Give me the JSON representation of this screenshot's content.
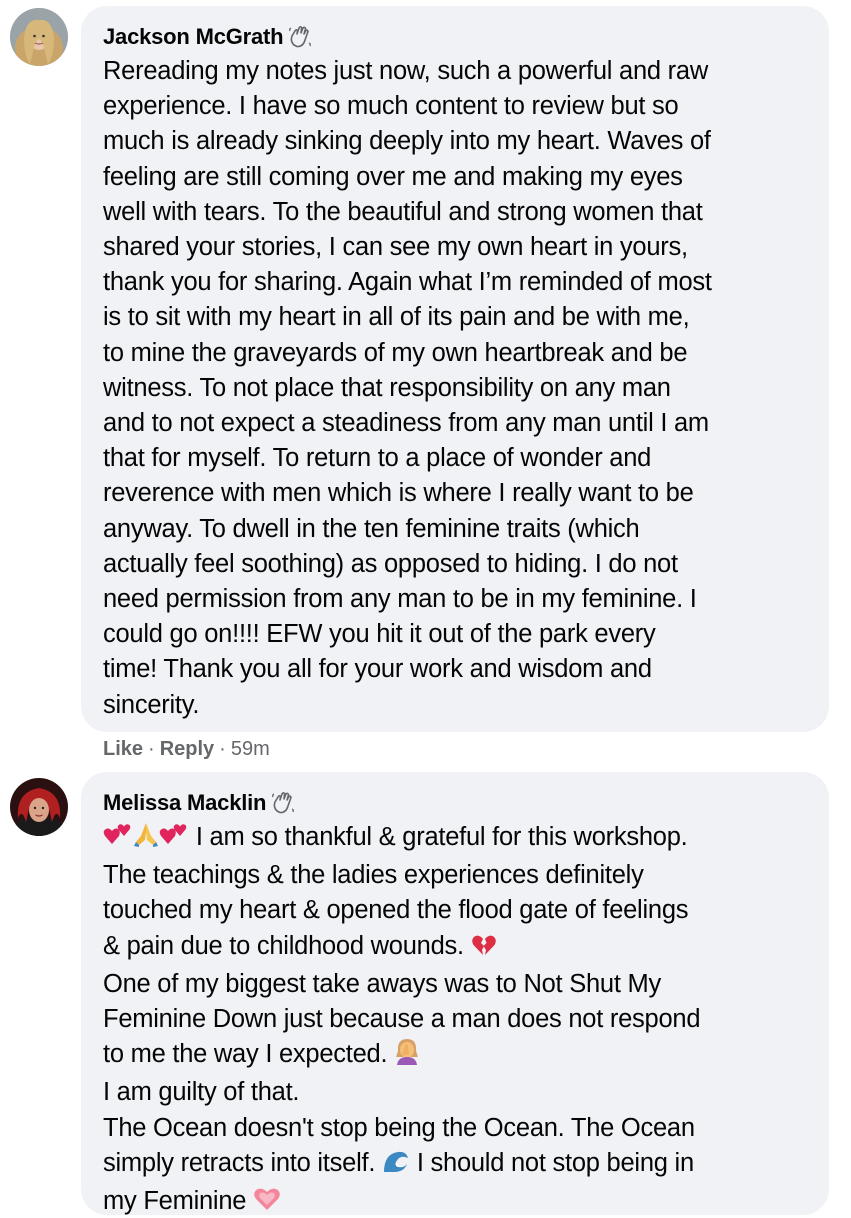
{
  "comments": [
    {
      "author": "Jackson McGrath",
      "lines": [
        "Rereading my notes just now, such a powerful and raw",
        "experience. I have so much content to review but so",
        "much is already sinking deeply into my heart. Waves of",
        "feeling are still coming over me and making my eyes",
        "well with tears. To the beautiful and strong women that",
        "shared your stories, I can see my own heart in yours,",
        "thank you for sharing. Again what I’m reminded of most",
        "is to sit with my heart in all of its pain and be with me,",
        "to mine the graveyards of my own heartbreak and be",
        "witness. To not place that responsibility on any man",
        "and to not expect a steadiness from any man until I am",
        "that for myself. To return to a place of wonder and",
        "reverence with men which is where I really want to be",
        "anyway. To dwell in the ten feminine traits (which",
        "actually feel soothing) as opposed to hiding. I do not",
        "need permission from any man to be in my feminine. I",
        "could go on!!!! EFW you hit it out of the park every",
        "time! Thank you all for your work and wisdom and",
        "sincerity."
      ],
      "actions": {
        "like": "Like",
        "reply": "Reply",
        "time": "59m"
      }
    },
    {
      "author": "Melissa Macklin",
      "line1": "I am so thankful & grateful for this workshop.",
      "line2": "The teachings & the ladies experiences definitely",
      "line3": "touched my heart & opened the flood gate of feelings",
      "line4": "& pain due to childhood wounds.",
      "line5": "One of my biggest take aways was to Not Shut My",
      "line6": "Feminine Down just because a man does not respond",
      "line7": "to me the way I expected.",
      "line8": "I am guilty of that.",
      "line9": "The Ocean doesn't stop being the Ocean. The Ocean",
      "line10a": "simply retracts into itself.",
      "line10b": "I should not stop being in",
      "line11": "my Feminine"
    }
  ],
  "icons": {
    "badge": "waving-hand-icon",
    "emoji_hearts": "two-hearts-icon",
    "emoji_pray": "folded-hands-icon",
    "emoji_broken": "broken-heart-icon",
    "emoji_facepalm": "woman-facepalming-icon",
    "emoji_wave": "water-wave-icon",
    "emoji_sparkle_heart": "growing-heart-icon"
  },
  "colors": {
    "bubble": "#f0f2f5",
    "text": "#050505",
    "meta": "#65676b"
  }
}
